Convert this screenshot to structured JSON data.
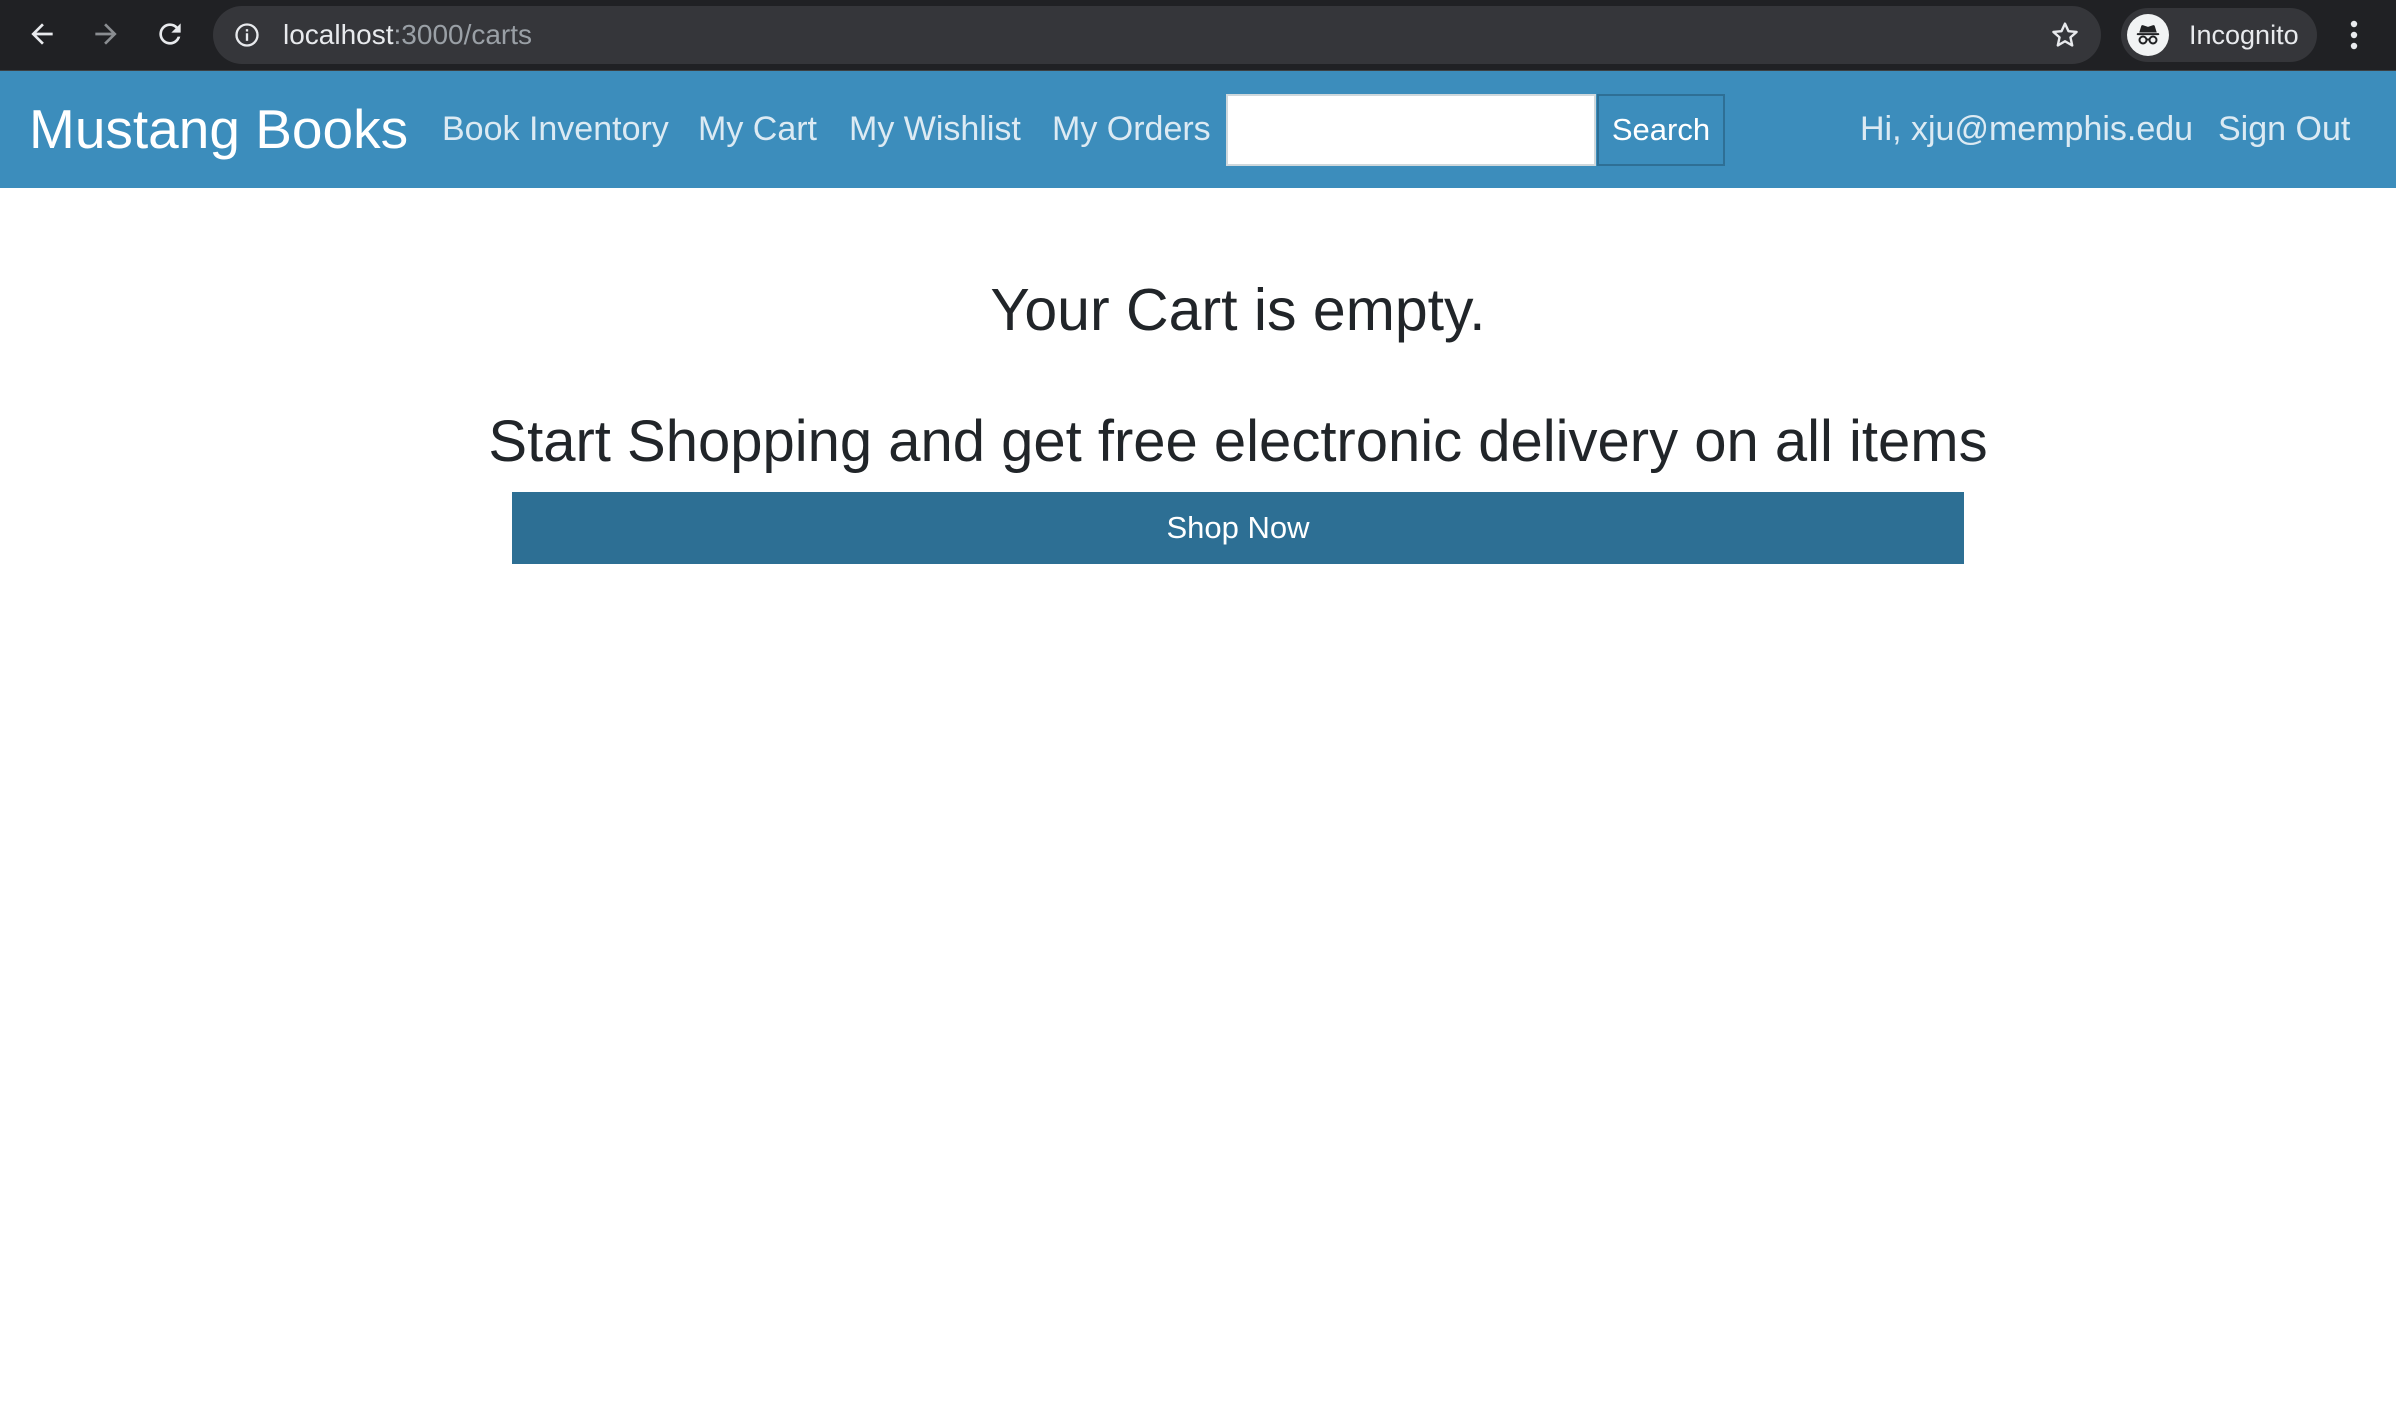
{
  "browser": {
    "url_host": "localhost",
    "url_path": ":3000/carts",
    "profile_label": "Incognito",
    "icons": {
      "back": "arrow-left-icon",
      "forward": "arrow-right-icon",
      "reload": "reload-icon",
      "site_info": "info-icon",
      "bookmark": "star-icon",
      "profile": "incognito-icon",
      "menu": "more-vertical-icon"
    }
  },
  "navbar": {
    "brand": "Mustang Books",
    "links": [
      {
        "label": "Book Inventory"
      },
      {
        "label": "My Cart"
      },
      {
        "label": "My Wishlist"
      },
      {
        "label": "My Orders"
      }
    ],
    "search": {
      "value": "",
      "button_label": "Search"
    },
    "greeting": "Hi, xju@memphis.edu",
    "sign_out": "Sign Out"
  },
  "main": {
    "empty_message": "Your Cart is empty.",
    "promo": "Start Shopping and get free electronic delivery on all items",
    "cta_label": "Shop Now"
  },
  "colors": {
    "chrome_bg": "#202124",
    "omnibox_bg": "#35363a",
    "navbar_bg": "#3c8dbc",
    "cta_bg": "#2d6f94",
    "text": "#212529"
  }
}
